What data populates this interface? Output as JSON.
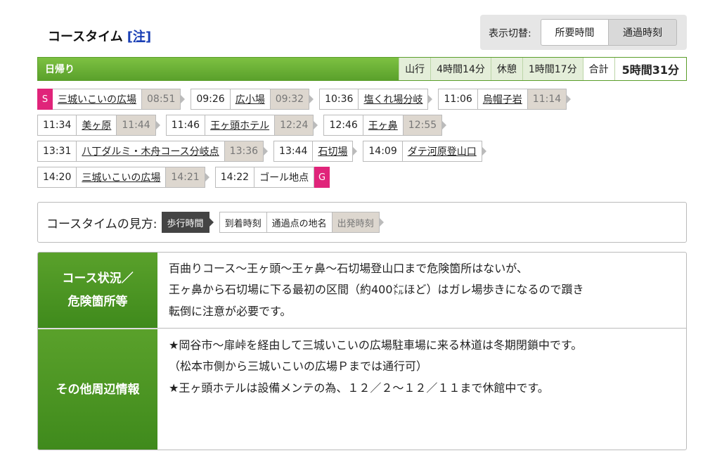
{
  "header": {
    "title": "コースタイム",
    "note_link": "[注]",
    "toggle_label": "表示切替:",
    "btn_required": "所要時間",
    "btn_passing": "通過時刻"
  },
  "summary": {
    "type": "日帰り",
    "climb_label": "山行",
    "climb_value": "4時間14分",
    "rest_label": "休憩",
    "rest_value": "1時間17分",
    "total_label": "合計",
    "total_value": "5時間31分"
  },
  "course": {
    "start_marker": "S",
    "goal_marker": "G",
    "stops": [
      {
        "arrive": "",
        "place": "三城いこいの広場",
        "depart": "08:51"
      },
      {
        "arrive": "09:26",
        "place": "広小場",
        "depart": "09:32"
      },
      {
        "arrive": "10:36",
        "place": "塩くれ場分岐",
        "depart": ""
      },
      {
        "arrive": "11:06",
        "place": "烏帽子岩",
        "depart": "11:14"
      },
      {
        "arrive": "11:34",
        "place": "美ヶ原",
        "depart": "11:44"
      },
      {
        "arrive": "11:46",
        "place": "王ヶ頭ホテル",
        "depart": "12:24"
      },
      {
        "arrive": "12:46",
        "place": "王ヶ鼻",
        "depart": "12:55"
      },
      {
        "arrive": "13:31",
        "place": "八丁ダルミ・木舟コース分岐点",
        "depart": "13:36"
      },
      {
        "arrive": "13:44",
        "place": "石切場",
        "depart": ""
      },
      {
        "arrive": "14:09",
        "place": "ダテ河原登山口",
        "depart": ""
      },
      {
        "arrive": "14:20",
        "place": "三城いこいの広場",
        "depart": "14:21"
      },
      {
        "arrive": "14:22",
        "place": "ゴール地点",
        "depart": ""
      }
    ]
  },
  "legend": {
    "title": "コースタイムの見方:",
    "walk": "歩行時間",
    "arrive": "到着時刻",
    "place": "通過点の地名",
    "depart": "出発時刻"
  },
  "info": {
    "danger_head_1": "コース状況／",
    "danger_head_2": "危険箇所等",
    "danger_line_1": "百曲りコース～王ヶ頭～王ヶ鼻～石切場登山口まで危険箇所はないが、",
    "danger_line_2": "王ヶ鼻から石切場に下る最初の区間（約400㍍ほど）はガレ場歩きになるので躓き",
    "danger_line_3": "転倒に注意が必要です。",
    "other_head": "その他周辺情報",
    "other_line_1": "★岡谷市～扉峠を経由して三城いこいの広場駐車場に来る林道は冬期閉鎖中です。",
    "other_line_2": "（松本市側から三城いこいの広場Ｐまでは通行可）",
    "other_line_3": "★王ヶ頭ホテルは設備メンテの為、１２／２～１２／１１まで休館中です。"
  }
}
